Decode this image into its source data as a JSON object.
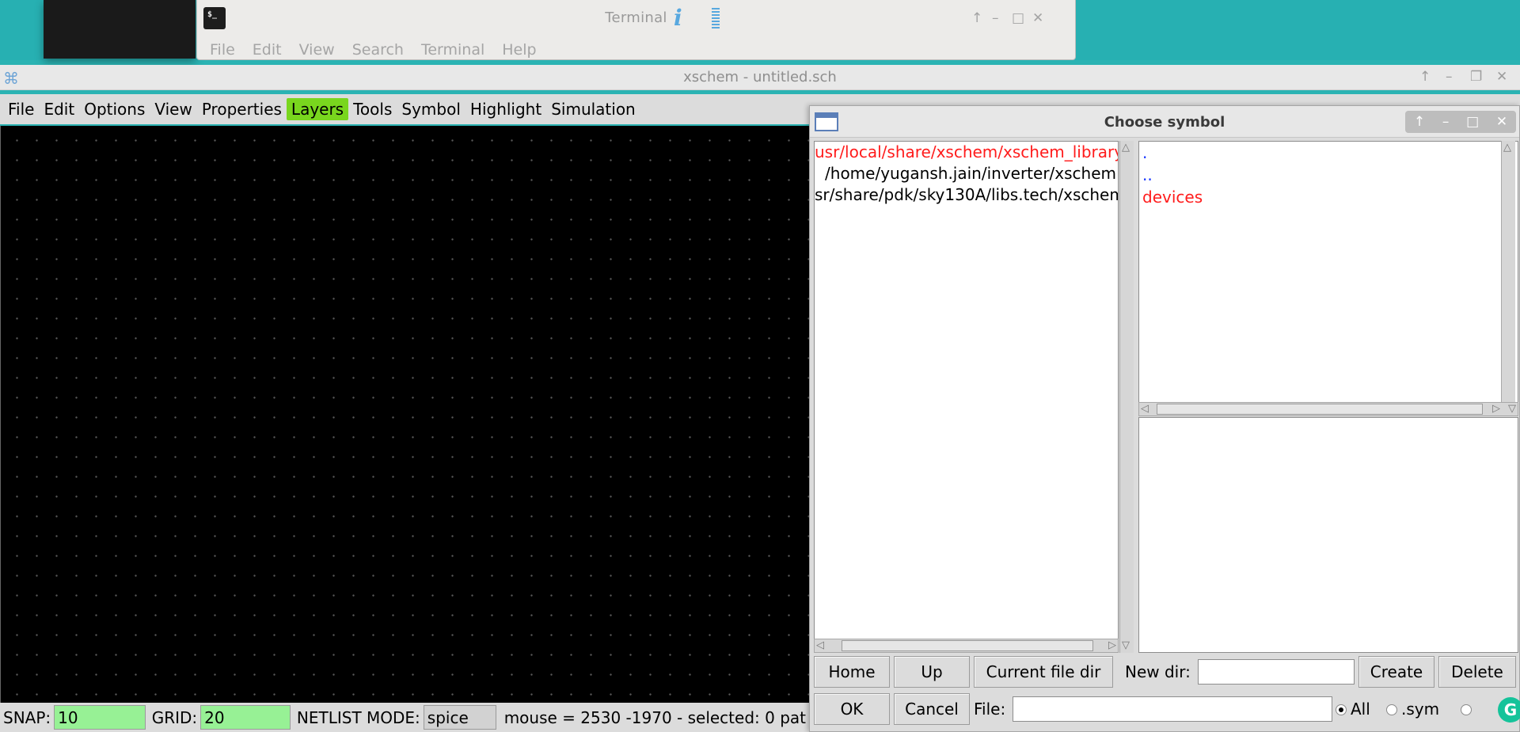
{
  "terminal": {
    "title": "Terminal",
    "menu": [
      "File",
      "Edit",
      "View",
      "Search",
      "Terminal",
      "Help"
    ],
    "win_buttons": [
      "↑",
      "–",
      "□",
      "✕"
    ]
  },
  "xschem": {
    "title": "xschem - untitled.sch",
    "win_buttons": [
      "↑",
      "–",
      "❐",
      "✕"
    ],
    "menu": [
      "File",
      "Edit",
      "Options",
      "View",
      "Properties",
      "Layers",
      "Tools",
      "Symbol",
      "Highlight",
      "Simulation"
    ],
    "highlighted_menu": "Layers",
    "status": {
      "snap_label": "SNAP:",
      "snap_value": "10",
      "grid_label": "GRID:",
      "grid_value": "20",
      "netlist_label": "NETLIST MODE:",
      "netlist_value": "spice",
      "mouse_text": "mouse = 2530 -1970 - selected: 0 pat"
    }
  },
  "dialog": {
    "title": "Choose symbol",
    "win_buttons": [
      "↑",
      "–",
      "□",
      "✕"
    ],
    "dirs": [
      "usr/local/share/xschem/xschem_library",
      "/home/yugansh.jain/inverter/xschem",
      "sr/share/pdk/sky130A/libs.tech/xschem"
    ],
    "selected_dir_index": 0,
    "files": [
      ".",
      "..",
      "devices"
    ],
    "buttons": {
      "home": "Home",
      "up": "Up",
      "current_file_dir": "Current file dir",
      "create": "Create",
      "delete": "Delete",
      "ok": "OK",
      "cancel": "Cancel"
    },
    "new_dir_label": "New dir:",
    "new_dir_value": "",
    "file_label": "File:",
    "file_value": "",
    "filter_all": "All",
    "filter_sym": ".sym",
    "filter_selected": "All"
  },
  "colors": {
    "highlight_green": "#79d61e",
    "status_green": "#97f195",
    "selected_red": "#ff1b1b",
    "link_blue": "#1433ff",
    "desktop_teal": "#27b0b2"
  }
}
